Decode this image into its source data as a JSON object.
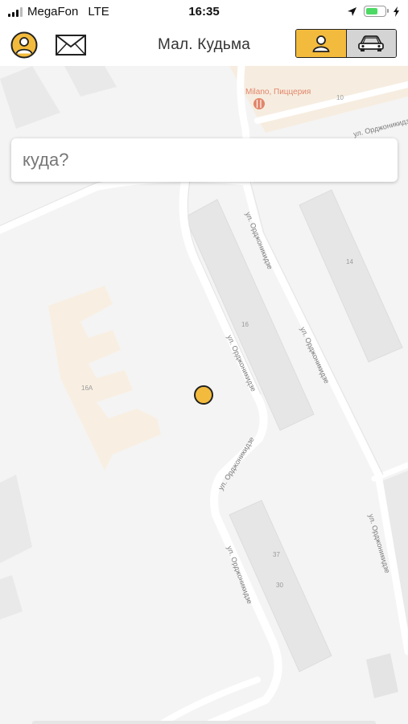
{
  "status_bar": {
    "carrier": "MegaFon",
    "network": "LTE",
    "time": "16:35"
  },
  "header": {
    "title": "Мал. Кудьма",
    "profile_icon": "person-circle-icon",
    "messages_icon": "envelope-icon",
    "mode_toggle": {
      "options": [
        "passenger",
        "driver"
      ],
      "selected": "passenger"
    }
  },
  "search": {
    "placeholder": "куда?"
  },
  "map": {
    "poi": "Milano, Пиццерия",
    "streets": [
      "ул. Орджоникидзе",
      "ул. Орджоникидзе",
      "ул. Орджоникидзе",
      "ул. Орджоникидзе",
      "ул. Орджоникидзе",
      "ул. Орджоникидзе",
      "ул. Орджоникидзе"
    ],
    "houses": [
      "10",
      "14",
      "16",
      "16А",
      "37",
      "30"
    ]
  },
  "colors": {
    "accent": "#f3bb3d",
    "map_background": "#f4f4f4",
    "poi_color": "#e2856a"
  }
}
